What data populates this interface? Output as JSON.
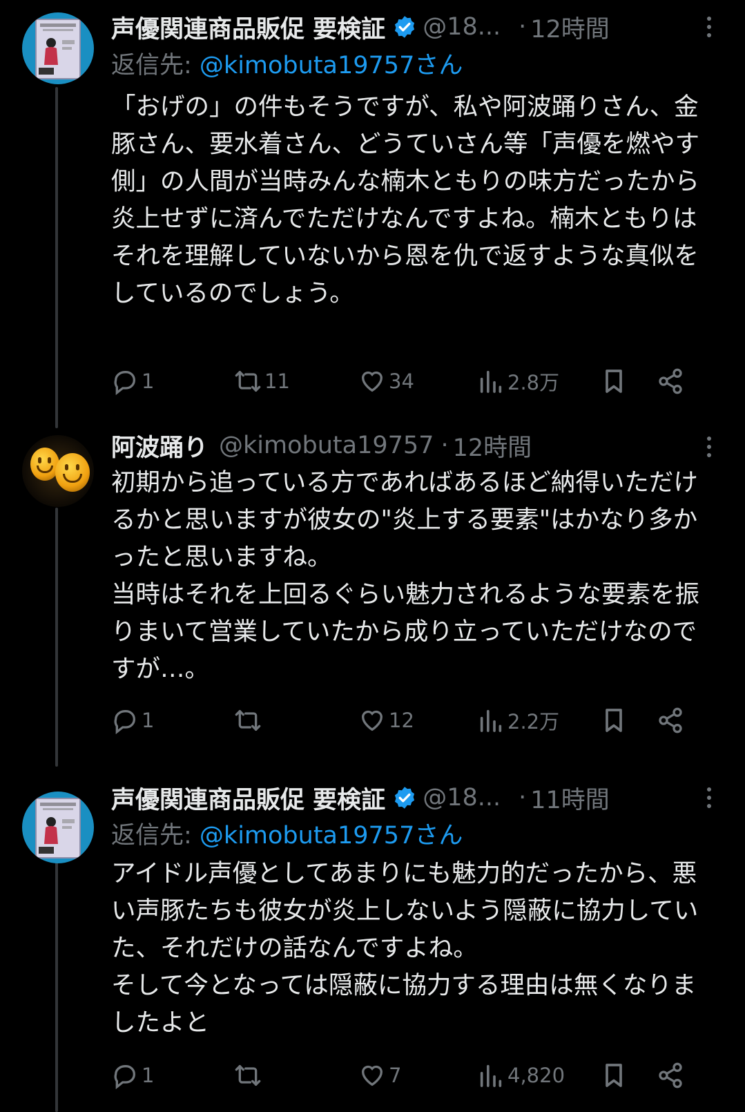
{
  "tweets": [
    {
      "name": "声優関連商品販促 要検証",
      "handle": "@18...",
      "dot": "·",
      "time": "12時間",
      "reply_prefix": "返信先: ",
      "reply_to": "@kimobuta19757さん",
      "text": "「おげの」の件もそうですが、私や阿波踊りさん、金豚さん、要水着さん、どうていさん等「声優を燃やす側」の人間が当時みんな楠木ともりの味方だったから炎上せずに済んでただけなんですよね。楠木ともりはそれを理解していないから恩を仇で返すような真似をしているのでしょう。",
      "replies": "1",
      "reposts": "11",
      "likes": "34",
      "views": "2.8万"
    },
    {
      "name": "阿波踊り",
      "handle": "@kimobuta19757",
      "dot": "·",
      "time": "12時間",
      "text": "初期から追っている方であればあるほど納得いただけるかと思いますが彼女の\"炎上する要素\"はかなり多かったと思いますね。\n当時はそれを上回るぐらい魅力されるような要素を振りまいて営業していたから成り立っていただけなのですが…。",
      "replies": "1",
      "reposts": "",
      "likes": "12",
      "views": "2.2万"
    },
    {
      "name": "声優関連商品販促 要検証",
      "handle": "@18...",
      "dot": "·",
      "time": "11時間",
      "reply_prefix": "返信先: ",
      "reply_to": "@kimobuta19757さん",
      "text": "アイドル声優としてあまりにも魅力的だったから、悪い声豚たちも彼女が炎上しないよう隠蔽に協力していた、それだけの話なんですよね。\nそして今となっては隠蔽に協力する理由は無くなりましたよと",
      "replies": "1",
      "reposts": "",
      "likes": "7",
      "views": "4,820"
    }
  ],
  "icons": {
    "verified": "verified-badge-icon",
    "reply": "reply-icon",
    "repost": "repost-icon",
    "like": "heart-icon",
    "views": "views-chart-icon",
    "bookmark": "bookmark-icon",
    "share": "share-icon",
    "more": "more-dots-icon"
  },
  "colors": {
    "background": "#000000",
    "text": "#e7e9ea",
    "muted": "#71767b",
    "link": "#1d9bf0",
    "thread_line": "#333639"
  }
}
